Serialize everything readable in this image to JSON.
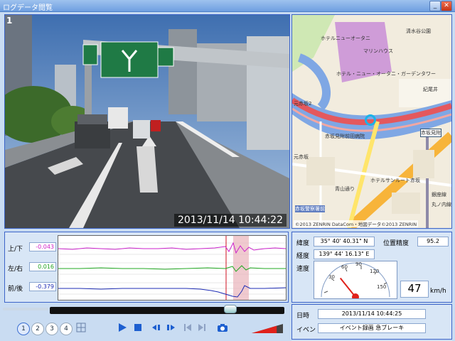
{
  "window": {
    "title": "ログデータ閲覧",
    "min_label": "_",
    "close_label": "✕"
  },
  "video": {
    "timestamp": "2013/11/14 10:44:22",
    "channel_number": "1"
  },
  "map": {
    "copyright": "©2013 ZENRIN DataCom・地図データ©2013 ZENRIN",
    "labels": {
      "hotel_new_otani": "ホテルニューオータニ",
      "shimizudani_park": "清水谷公園",
      "marine_house": "マリンハウス",
      "hotel_new_otani_garden_tower": "ホテル・ニュー・オータニ・ガーデンタワー",
      "kioicho": "紀尾井",
      "akasaka_mitsuke": "赤坂見附",
      "moto_akasaka_2": "元赤坂2",
      "akasaka_hospital": "赤坂見附前田病院",
      "moto_akasaka": "元赤坂",
      "hotel_sanroute_akasaka": "ホテルサンルート赤坂",
      "aoyama_dori": "青山通り",
      "akasaka_police": "赤坂警察署前",
      "ginza_line": "銀座線",
      "marunouchi_line": "丸ノ内線"
    }
  },
  "sensors": {
    "updown_label": "上/下",
    "updown_value": "-0.043",
    "leftright_label": "左/右",
    "leftright_value": "0.016",
    "frontback_label": "前/後",
    "frontback_value": "-0.379"
  },
  "info": {
    "lat_label": "緯度",
    "lat_value": "35° 40' 40.31\" N",
    "accuracy_label": "位置精度",
    "accuracy_value": "95.2",
    "lon_label": "経度",
    "lon_value": "139° 44' 16.13\" E",
    "speed_label": "速度",
    "speed_value": "47",
    "speed_unit": "km/h",
    "gauge_ticks": [
      "30",
      "60",
      "90",
      "120",
      "150"
    ]
  },
  "details": {
    "datetime_label": "日時",
    "datetime_value": "2013/11/14 10:44:25",
    "event_label": "イベント",
    "event_value": "イベント録画 急ブレーキ"
  },
  "controls": {
    "channel_1": "1",
    "channel_2": "2",
    "channel_3": "3",
    "channel_4": "4",
    "playback_position": 0.78,
    "volume_level": 0.8
  }
}
